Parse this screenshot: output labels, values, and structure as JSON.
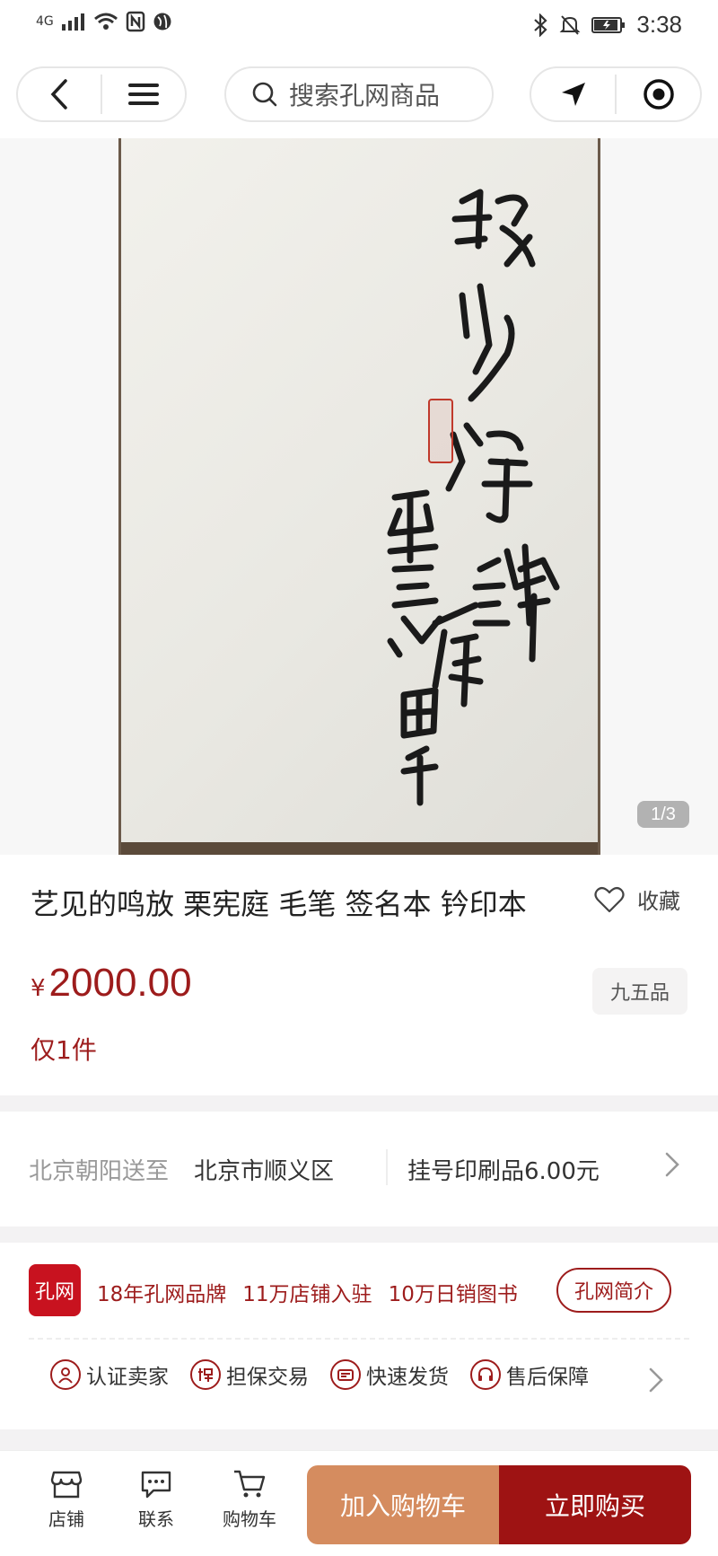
{
  "status_bar": {
    "network": "4G",
    "time": "3:38"
  },
  "search": {
    "placeholder": "搜索孔网商品"
  },
  "gallery": {
    "page_indicator": "1/3"
  },
  "product": {
    "title": "艺见的鸣放 栗宪庭 毛笔 签名本 钤印本",
    "favorite_label": "收藏",
    "currency": "¥",
    "price": "2000.00",
    "stock": "仅1件",
    "condition": "九五品"
  },
  "shipping": {
    "from_label": "北京朝阳送至",
    "destination": "北京市顺义区",
    "fee": "挂号印刷品6.00元"
  },
  "brand": {
    "logo_text": "孔网",
    "slogans": [
      "18年孔网品牌",
      "11万店铺入驻",
      "10万日销图书"
    ],
    "intro_button": "孔网简介",
    "features": [
      "认证卖家",
      "担保交易",
      "快速发货",
      "售后保障"
    ]
  },
  "bottom_bar": {
    "tabs": [
      "店铺",
      "联系",
      "购物车"
    ],
    "add_to_cart": "加入购物车",
    "buy_now": "立即购买"
  },
  "colors": {
    "accent": "#9d1c1c",
    "cart": "#d58c5f",
    "buy": "#9e1313"
  }
}
